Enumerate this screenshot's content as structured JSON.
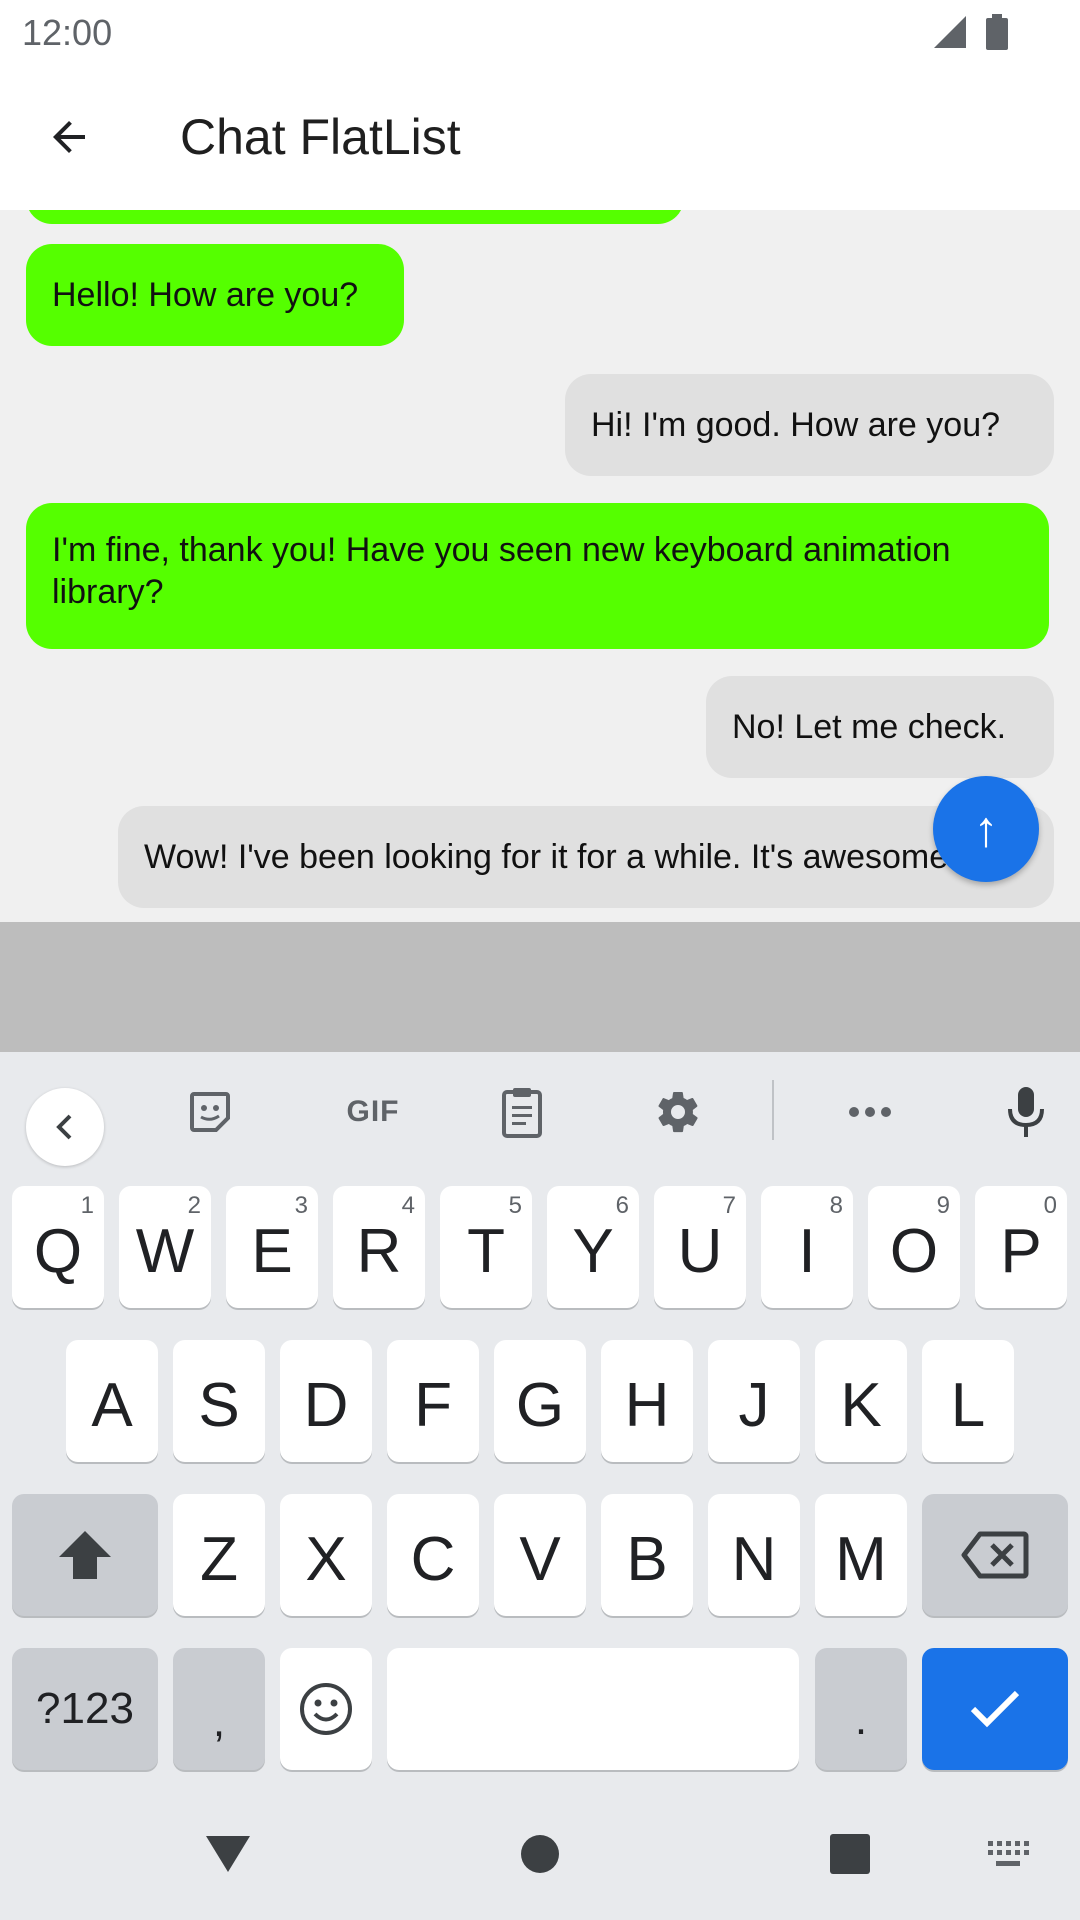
{
  "status_bar": {
    "time": "12:00"
  },
  "app_bar": {
    "title": "Chat FlatList"
  },
  "messages": [
    {
      "text": "Hello! How are you?",
      "side": "left"
    },
    {
      "text": "Hi! I'm good. How are you?",
      "side": "right"
    },
    {
      "text": "I'm fine, thank you! Have you seen new keyboard animation library?",
      "side": "left"
    },
    {
      "text": "No! Let me check.",
      "side": "right"
    },
    {
      "text": "Wow! I've been looking for it for a while. It's awesome!",
      "side": "right"
    }
  ],
  "scroll_button": {
    "label": "↑"
  },
  "keyboard": {
    "toolbar": {
      "gif_label": "GIF"
    },
    "row1": [
      {
        "key": "Q",
        "hint": "1"
      },
      {
        "key": "W",
        "hint": "2"
      },
      {
        "key": "E",
        "hint": "3"
      },
      {
        "key": "R",
        "hint": "4"
      },
      {
        "key": "T",
        "hint": "5"
      },
      {
        "key": "Y",
        "hint": "6"
      },
      {
        "key": "U",
        "hint": "7"
      },
      {
        "key": "I",
        "hint": "8"
      },
      {
        "key": "O",
        "hint": "9"
      },
      {
        "key": "P",
        "hint": "0"
      }
    ],
    "row2": [
      "A",
      "S",
      "D",
      "F",
      "G",
      "H",
      "J",
      "K",
      "L"
    ],
    "row3": [
      "Z",
      "X",
      "C",
      "V",
      "B",
      "N",
      "M"
    ],
    "symbols_label": "?123",
    "comma_label": ",",
    "period_label": "."
  },
  "colors": {
    "sent_bubble": "#55ff00",
    "received_bubble": "#e0e0e0",
    "accent": "#1a73e8"
  }
}
